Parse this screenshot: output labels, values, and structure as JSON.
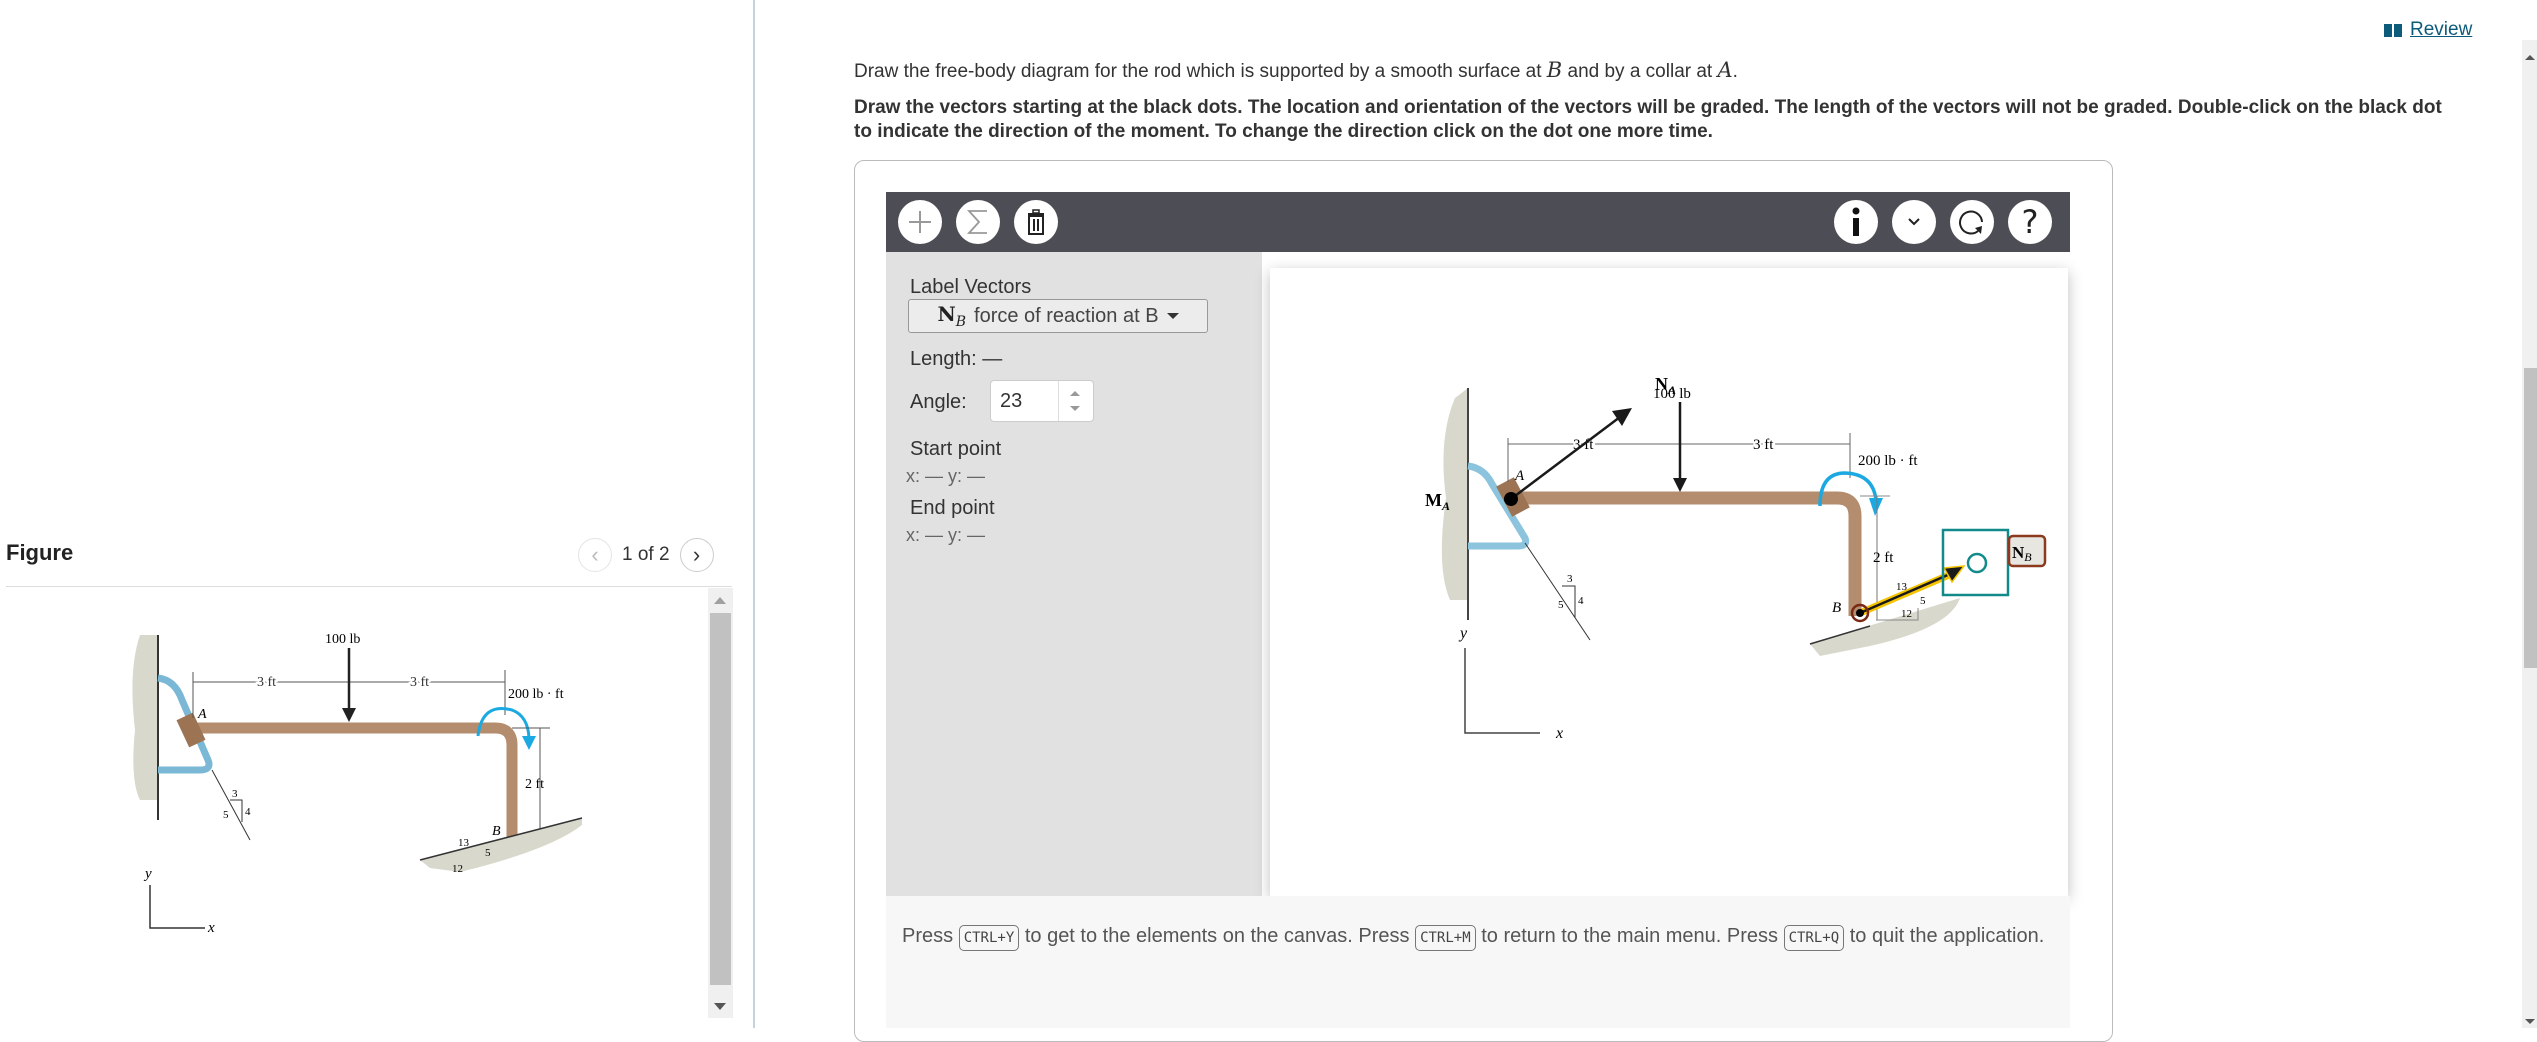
{
  "figure_panel": {
    "title": "Figure",
    "pager_text": "1 of 2",
    "prev_icon": "chevron-left-icon",
    "next_icon": "chevron-right-icon",
    "figure_labels": {
      "force": "100 lb",
      "dim_left": "3 ft",
      "dim_right": "3 ft",
      "moment": "200 lb · ft",
      "height": "2 ft",
      "point_a": "A",
      "point_b": "B",
      "slope_a": [
        "3",
        "4",
        "5"
      ],
      "slope_b": [
        "13",
        "5",
        "12"
      ],
      "axis_x": "x",
      "axis_y": "y"
    }
  },
  "header": {
    "review_label": "Review",
    "review_icon": "book-icon"
  },
  "question": {
    "text_prefix": "Draw the free-body diagram for the rod which is supported by a smooth surface at ",
    "var_b": "B",
    "text_mid": " and by a collar at ",
    "var_a": "A",
    "text_suffix": ".",
    "instructions": "Draw the vectors starting at the black dots. The location and orientation of the vectors will be graded. The length of the vectors will not be graded. Double-click on the black dot to indicate the direction of the moment. To change the direction click on the dot one more time."
  },
  "toolbar": {
    "left_buttons": [
      "add-vector",
      "sum",
      "delete"
    ],
    "right_buttons": [
      "info",
      "expand",
      "reset",
      "help"
    ]
  },
  "side_panel": {
    "label_vectors": "Label Vectors",
    "selected_vector_symbol": "N",
    "selected_vector_sub": "B",
    "selected_vector_desc": "force of reaction at B",
    "length_label": "Length:",
    "length_value": "—",
    "angle_label": "Angle:",
    "angle_value": "23",
    "start_label": "Start point",
    "start_coords": "x: — y: —",
    "end_label": "End point",
    "end_coords": "x: — y: —"
  },
  "canvas": {
    "labels": {
      "na": "N",
      "na_sub": "A",
      "ma": "M",
      "ma_sub": "A",
      "nb": "N",
      "nb_sub": "B",
      "force": "100 lb",
      "dim_left": "3 ft",
      "dim_right": "3 ft",
      "moment": "200 lb · ft",
      "height": "2 ft",
      "point_a": "A",
      "point_b": "B",
      "slope_a": [
        "3",
        "4",
        "5"
      ],
      "slope_b": [
        "13",
        "5",
        "12"
      ],
      "axis_x": "x",
      "axis_y": "y"
    },
    "colors": {
      "rod": "#b48c6e",
      "moment_arrow": "#1ba9e1",
      "selected_vector": "#f5c400",
      "target_box": "#138a8a",
      "label_border": "#8b3a1e"
    }
  },
  "help_text": {
    "press": "Press",
    "key1": "CTRL+Y",
    "after1": "to get to the elements on the canvas. Press",
    "key2": "CTRL+M",
    "after2": "to return to the main menu. Press",
    "key3": "CTRL+Q",
    "after3": "to quit the application."
  }
}
